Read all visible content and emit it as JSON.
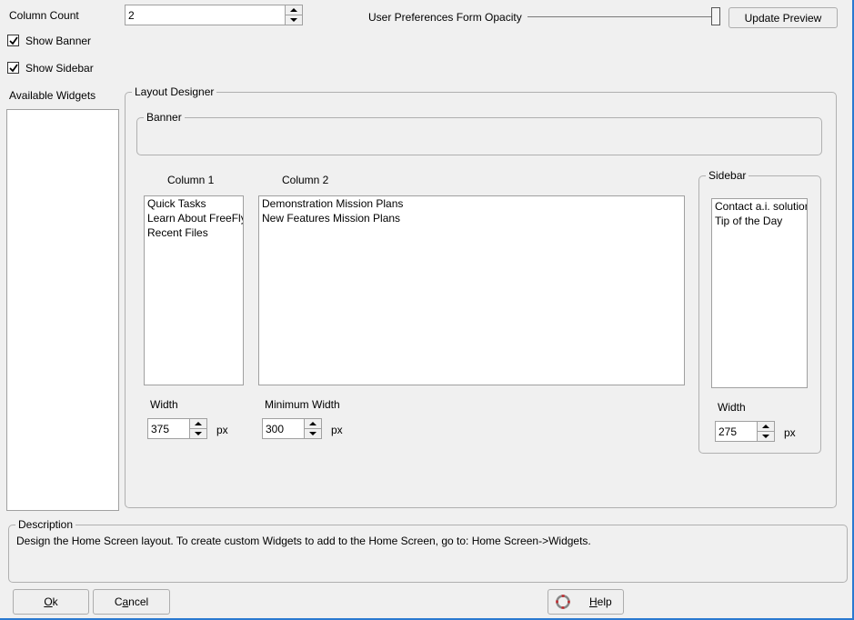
{
  "column_count": {
    "label": "Column Count",
    "value": "2"
  },
  "show_banner": {
    "label": "Show Banner",
    "checked": true
  },
  "show_sidebar": {
    "label": "Show Sidebar",
    "checked": true
  },
  "opacity": {
    "label": "User Preferences Form Opacity",
    "value_percent": 100
  },
  "update_preview_label": "Update Preview",
  "available_widgets": {
    "label": "Available Widgets",
    "items": []
  },
  "layout_designer": {
    "title": "Layout Designer",
    "banner_title": "Banner",
    "column1": {
      "label": "Column 1",
      "items": [
        "Quick Tasks",
        "Learn About FreeFly",
        "Recent Files"
      ],
      "width_label": "Width",
      "width_value": "375",
      "unit": "px"
    },
    "column2": {
      "label": "Column 2",
      "items": [
        "Demonstration Mission Plans",
        "New Features Mission Plans"
      ],
      "min_width_label": "Minimum Width",
      "min_width_value": "300",
      "unit": "px"
    },
    "sidebar": {
      "title": "Sidebar",
      "items": [
        "Contact a.i. solutions",
        "Tip of the Day"
      ],
      "width_label": "Width",
      "width_value": "275",
      "unit": "px"
    }
  },
  "description": {
    "title": "Description",
    "text": "Design the Home Screen layout.  To create custom Widgets to add to the Home Screen, go to: Home Screen->Widgets."
  },
  "buttons": {
    "ok": {
      "mnemonic": "O",
      "rest": "k"
    },
    "cancel": {
      "pre": "C",
      "mnemonic": "a",
      "rest": "ncel"
    },
    "help": {
      "mnemonic": "H",
      "rest": "elp"
    }
  },
  "colors": {
    "window_border": "#2b79d0",
    "help_icon": "#c0282c"
  }
}
